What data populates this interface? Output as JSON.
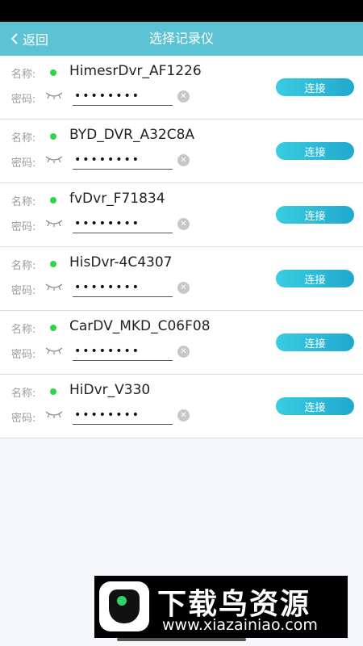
{
  "header": {
    "back_label": "返回",
    "title": "选择记录仪"
  },
  "labels": {
    "name": "名称:",
    "password": "密码:",
    "connect": "连接"
  },
  "devices": [
    {
      "ssid": "HimesrDvr_AF1226",
      "password_mask": "••••••••"
    },
    {
      "ssid": "BYD_DVR_A32C8A",
      "password_mask": "••••••••"
    },
    {
      "ssid": "fvDvr_F71834",
      "password_mask": "••••••••"
    },
    {
      "ssid": "HisDvr-4C4307",
      "password_mask": "••••••••"
    },
    {
      "ssid": "CarDV_MKD_C06F08",
      "password_mask": "••••••••"
    },
    {
      "ssid": "HiDvr_V330",
      "password_mask": "••••••••"
    }
  ],
  "watermark": {
    "title": "下载鸟资源",
    "url": "www.xiazainiao.com"
  },
  "colors": {
    "accent": "#5bc3d3",
    "status_dot": "#2bd64a"
  }
}
